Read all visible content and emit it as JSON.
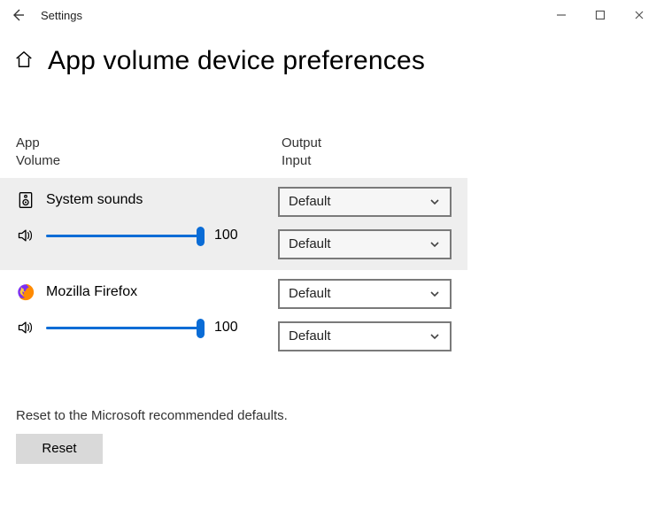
{
  "window": {
    "title": "Settings"
  },
  "page": {
    "title": "App volume  device preferences"
  },
  "columns": {
    "left_line1": "App",
    "left_line2": "Volume",
    "right_line1": "Output",
    "right_line2": "Input"
  },
  "apps": [
    {
      "name": "System sounds",
      "icon": "speaker-box-icon",
      "volume": 100,
      "output": "Default",
      "input": "Default",
      "highlighted": true
    },
    {
      "name": "Mozilla Firefox",
      "icon": "firefox-icon",
      "volume": 100,
      "output": "Default",
      "input": "Default",
      "highlighted": false
    }
  ],
  "reset": {
    "caption": "Reset to the Microsoft recommended defaults.",
    "button": "Reset"
  }
}
